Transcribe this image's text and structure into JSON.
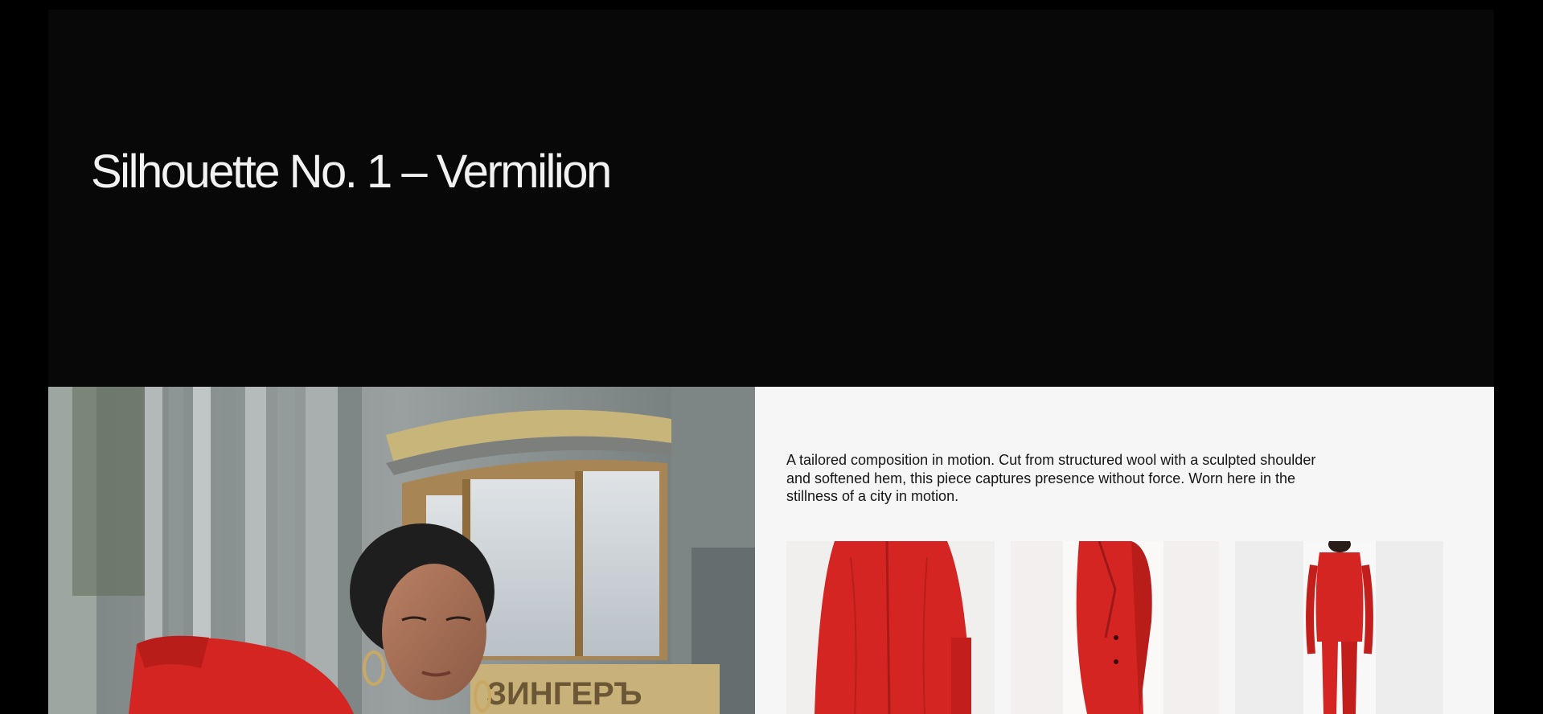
{
  "hero": {
    "title": "Silhouette No. 1 – Vermilion"
  },
  "lookbook": {
    "description": "A tailored composition in motion. Cut from structured wool with a sculpted shoulder and softened hem, this piece captures presence without force. Worn here in the stillness of a city in motion.",
    "main_photo": {
      "storefront_sign": "ЗИНГЕРЪ"
    },
    "thumbnails": [
      {
        "view": "back-close-up"
      },
      {
        "view": "side-three-quarter"
      },
      {
        "view": "back-full-length"
      }
    ]
  },
  "colors": {
    "page_background": "#080809",
    "outer_background": "#000000",
    "title_text": "#f2f2f2",
    "panel_background": "#f6f6f6",
    "body_text": "#151515",
    "suit_red": "#d42522"
  }
}
